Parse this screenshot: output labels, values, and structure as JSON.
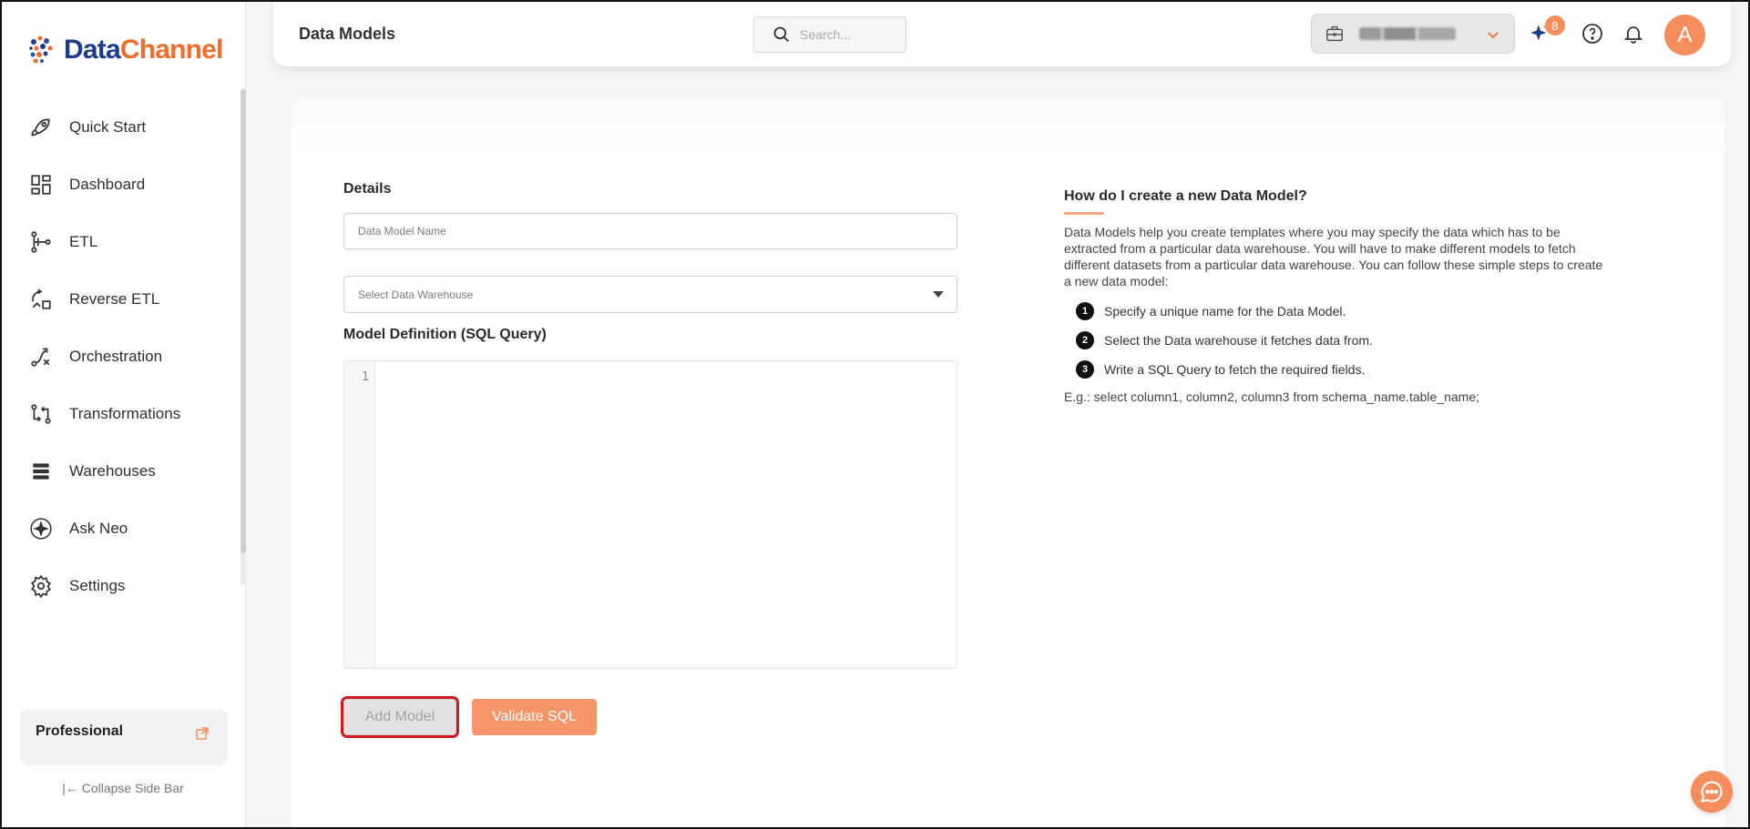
{
  "brand": {
    "part1": "Data",
    "part2": "Channel",
    "primary_color": "#1e3a8a",
    "accent_color": "#f26c2c"
  },
  "sidebar": {
    "items": [
      {
        "label": "Quick Start",
        "icon": "rocket-icon"
      },
      {
        "label": "Dashboard",
        "icon": "dashboard-icon"
      },
      {
        "label": "ETL",
        "icon": "etl-icon"
      },
      {
        "label": "Reverse ETL",
        "icon": "reverse-etl-icon"
      },
      {
        "label": "Orchestration",
        "icon": "orchestration-icon"
      },
      {
        "label": "Transformations",
        "icon": "transformations-icon"
      },
      {
        "label": "Warehouses",
        "icon": "warehouses-icon"
      },
      {
        "label": "Ask Neo",
        "icon": "ask-neo-icon"
      },
      {
        "label": "Settings",
        "icon": "settings-icon"
      }
    ],
    "plan": {
      "name": "Professional"
    },
    "collapse_label": "Collapse Side Bar"
  },
  "header": {
    "title": "Data Models",
    "search_placeholder": "Search...",
    "notification_count": "8",
    "avatar_initial": "A"
  },
  "form": {
    "details_label": "Details",
    "name_placeholder": "Data Model Name",
    "warehouse_placeholder": "Select Data Warehouse",
    "definition_label": "Model Definition (SQL Query)",
    "editor_line": "1",
    "add_button": "Add Model",
    "validate_button": "Validate SQL"
  },
  "help": {
    "title": "How do I create a new Data Model?",
    "description": "Data Models help you create templates where you may specify the data which has to be extracted from a particular data warehouse. You will have to make different models to fetch different datasets from a particular data warehouse. You can follow these simple steps to create a new data model:",
    "steps": [
      {
        "num": "1",
        "text": "Specify a unique name for the Data Model."
      },
      {
        "num": "2",
        "text": "Select the Data warehouse it fetches data from."
      },
      {
        "num": "3",
        "text": "Write a SQL Query to fetch the required fields."
      }
    ],
    "example": "E.g.: select column1, column2, column3 from schema_name.table_name;"
  }
}
